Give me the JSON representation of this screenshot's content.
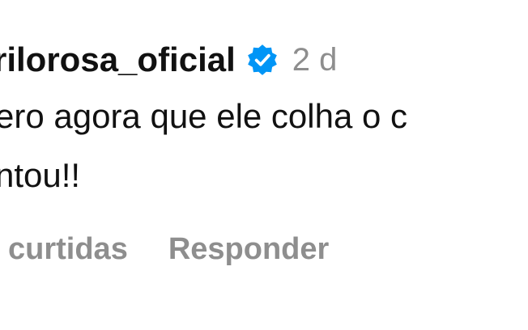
{
  "comment": {
    "username": "rilorosa_oficial",
    "verified": true,
    "timestamp": "2 d",
    "text_lines": [
      "ero agora que ele colha o c",
      "ntou!!"
    ]
  },
  "actions": {
    "likes_label": "curtidas",
    "reply_label": "Responder"
  },
  "colors": {
    "text": "#111111",
    "muted": "#8e8e8e",
    "verified_badge": "#0095f6"
  },
  "icons": {
    "verified": "verified-badge-icon"
  }
}
